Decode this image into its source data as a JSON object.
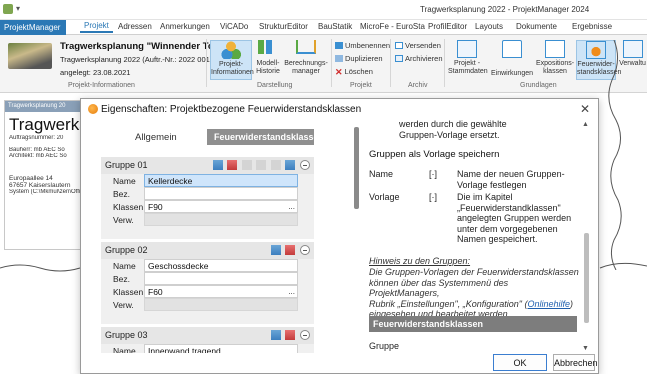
{
  "window": {
    "title": "Tragwerksplanung 2022 - ProjektManager 2024"
  },
  "tabs": {
    "app": "ProjektManager",
    "items": [
      "Projekt",
      "Adressen",
      "Anmerkungen",
      "ViCADo",
      "StrukturEditor",
      "BauStatik",
      "MicroFe - EuroSta",
      "ProfilEditor",
      "Layouts",
      "Dokumente",
      "Ergebnisse"
    ]
  },
  "ribbon": {
    "project_title": "Tragwerksplanung \"Winnender Tor\"",
    "project_sub": "Tragwerksplanung 2022 (Auftr.-Nr.: 2022 001)",
    "project_date": "angelegt: 23.08.2021",
    "group_projekt_info": "Projekt-Informationen",
    "btn_proj_info": "Projekt-\nInformationen",
    "btn_modell_historie": "Modell-\nHistorie",
    "btn_berechnungsmanager": "Berechnungs-\nmanager",
    "group_darstellung": "Darstellung",
    "btn_umbenennen": "Umbenennen",
    "btn_duplizieren": "Duplizieren",
    "btn_loeschen": "Löschen",
    "group_projekt": "Projekt",
    "btn_versenden": "Versenden",
    "btn_archivieren": "Archivieren",
    "group_archiv": "Archiv",
    "btn_stammdaten": "Projekt -\nStammdaten",
    "btn_einwirkungen": "Einwirkungen",
    "btn_expositionsklassen": "Expositions-\nklassen",
    "btn_feuerwiderstand": "Feuerwider-\nstandsklassen",
    "btn_verwaltung": "Verwaltu",
    "group_grundlagen": "Grundlagen"
  },
  "bgdoc": {
    "header": "Tragwerksplanung 20",
    "big": "Tragwerksp",
    "lines": [
      "Auftragsnummer: 20",
      "",
      "Bauherr:   mb AEC So",
      "Architekt:  mb AEC So",
      "",
      "",
      "Europaallee 14",
      "67657 Kaiserslautern",
      "System (C:\\Mkmul\\zen\\Offi"
    ]
  },
  "dialog": {
    "title": "Eigenschaften: Projektbezogene Feuerwiderstandsklassen",
    "seg_allgemein": "Allgemein",
    "seg_feuer": "Feuerwiderstandsklassen",
    "labels": {
      "name": "Name",
      "bez": "Bez.",
      "klassen": "Klassen",
      "verw": "Verw."
    },
    "groups": [
      {
        "title": "Gruppe 01",
        "name": "Kellerdecke",
        "bez": "",
        "klassen": "F90",
        "verw": ""
      },
      {
        "title": "Gruppe 02",
        "name": "Geschossdecke",
        "bez": "",
        "klassen": "F60",
        "verw": ""
      },
      {
        "title": "Gruppe 03",
        "name": "Innenwand tragend",
        "bez": ""
      }
    ],
    "right": {
      "top_text": "werden durch die gewählte\nGruppen-Vorlage ersetzt.",
      "heading": "Gruppen als Vorlage speichern",
      "row1_label": "Name",
      "row1_mark": "[·]",
      "row1_text": "Name der neuen Gruppen-\nVorlage festlegen",
      "row2_label": "Vorlage",
      "row2_mark": "[·]",
      "row2_text": "Die im Kapitel\n„Feuerwiderstandklassen\"\nangelegten Gruppen werden\nunter dem vorgegebenen\nNamen gespeichert.",
      "hint_title": "Hinweis zu den Gruppen:",
      "hint_text": "Die Gruppen-Vorlagen der Feuerwiderstandsklassen\nkönnen über das Systemmenü des ProjektManagers,\nRubrik „Einstellungen\", „Konfiguration\" (",
      "hint_link": "Onlinehilfe",
      "hint_tail": ")\neingesehen und bearbeitet werden.",
      "bar": "Feuerwiderstandsklassen",
      "next_heading": "Gruppe"
    },
    "ok": "OK",
    "cancel": "Abbrechen"
  },
  "colors": {
    "accent": "#2b78b5",
    "selected": "#cfe5fb",
    "bar": "#7d7d7d"
  }
}
